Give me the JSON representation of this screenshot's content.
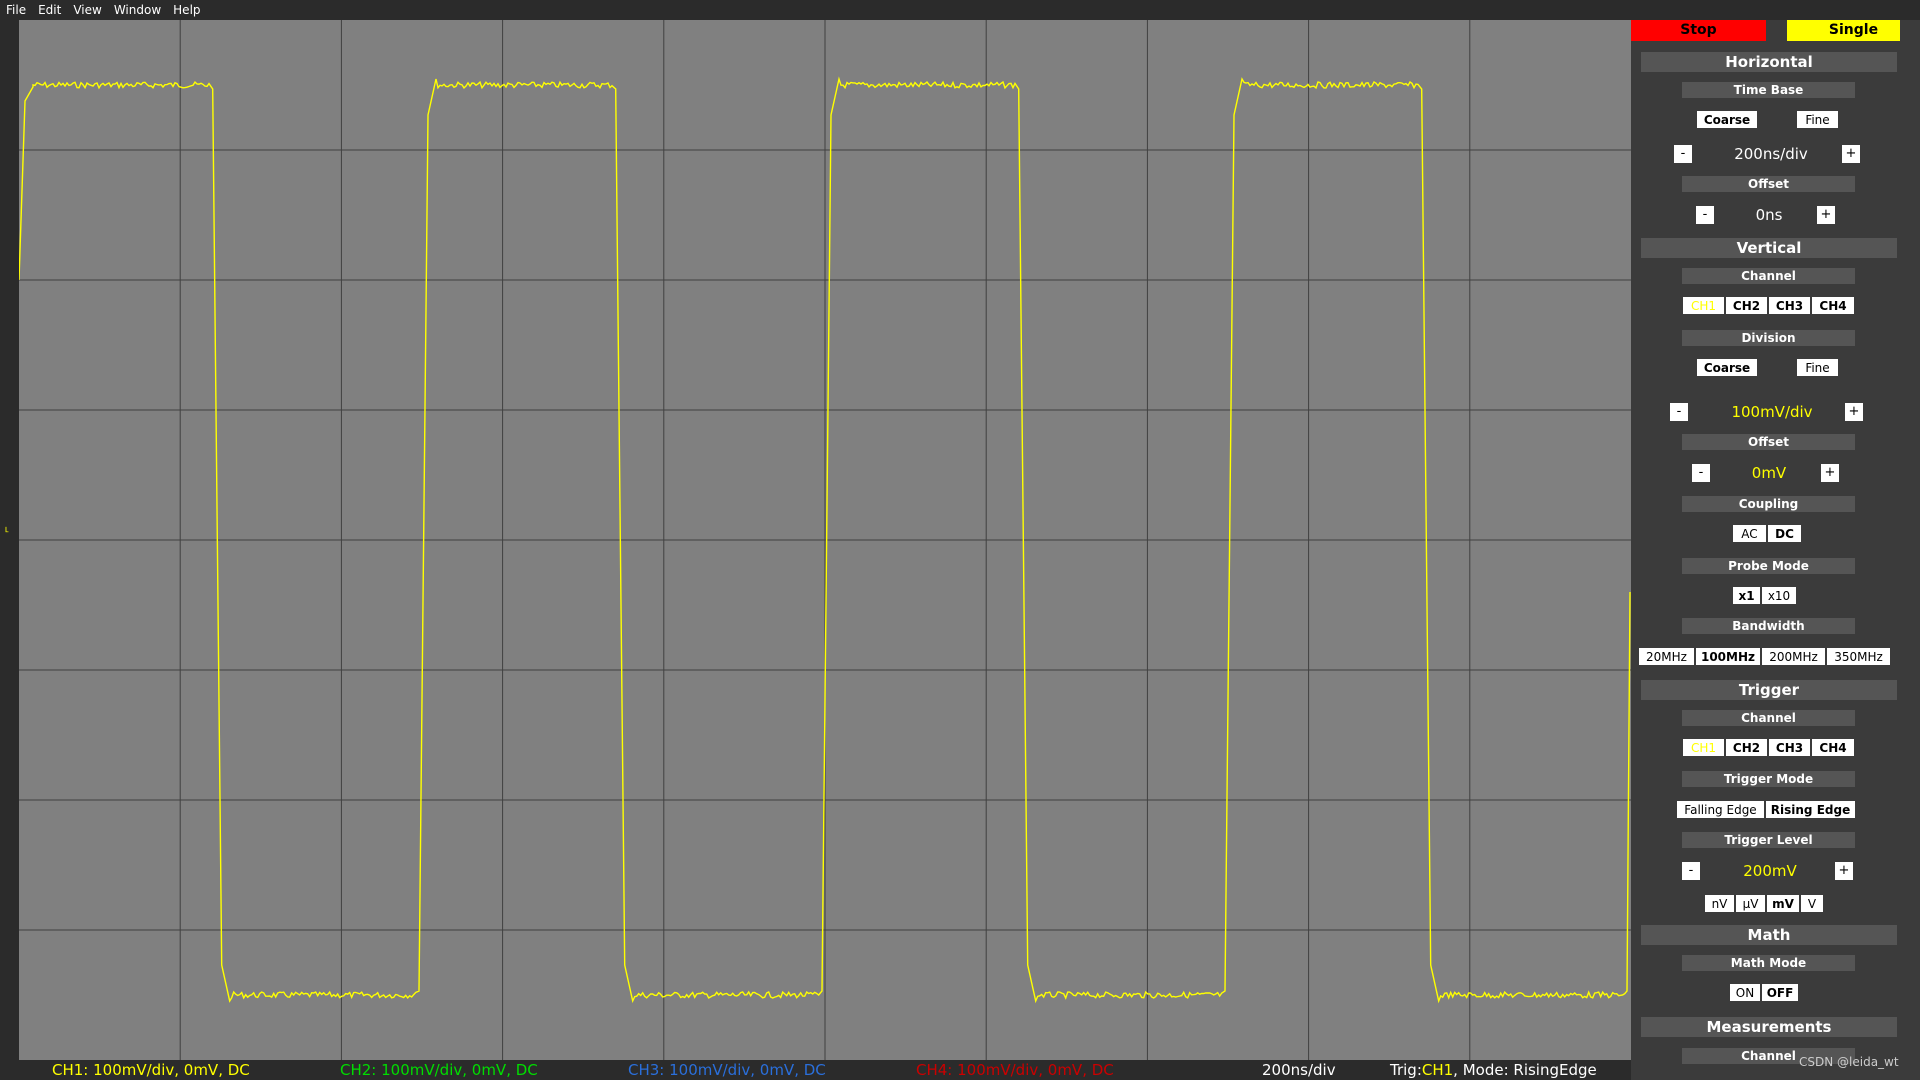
{
  "menu": [
    "File",
    "Edit",
    "View",
    "Window",
    "Help"
  ],
  "trigger_marker": "˪",
  "status": {
    "ch1": "CH1: 100mV/div, 0mV, DC",
    "ch2": "CH2: 100mV/div, 0mV, DC",
    "ch3": "CH3: 100mV/div, 0mV, DC",
    "ch4": "CH4: 100mV/div, 0mV, DC",
    "timebase": "200ns/div",
    "trig_prefix": "Trig:",
    "trig_channel": "CH1",
    "trig_mode": ", Mode: RisingEdge"
  },
  "colors": {
    "ch1": "#ffff00",
    "ch2": "#00dd00",
    "ch3": "#2a6fdb",
    "ch4": "#cc0000",
    "stop": "#ff0000",
    "single": "#ffff00",
    "grid": "#404040",
    "screen": "#808080"
  },
  "panel": {
    "stop": "Stop",
    "single": "Single",
    "horizontal": {
      "title": "Horizontal",
      "time_base": "Time Base",
      "coarse": "Coarse",
      "fine": "Fine",
      "minus": "-",
      "plus": "+",
      "time_value": "200ns/div",
      "offset": "Offset",
      "offset_value": "0ns"
    },
    "vertical": {
      "title": "Vertical",
      "channel": "Channel",
      "channels": [
        "CH1",
        "CH2",
        "CH3",
        "CH4"
      ],
      "division": "Division",
      "coarse": "Coarse",
      "fine": "Fine",
      "div_value": "100mV/div",
      "offset": "Offset",
      "offset_value": "0mV",
      "coupling": "Coupling",
      "ac": "AC",
      "dc": "DC",
      "probe_mode": "Probe Mode",
      "x1": "x1",
      "x10": "x10",
      "bandwidth": "Bandwidth",
      "bandwidths": [
        "20MHz",
        "100MHz",
        "200MHz",
        "350MHz"
      ]
    },
    "trigger": {
      "title": "Trigger",
      "channel": "Channel",
      "channels": [
        "CH1",
        "CH2",
        "CH3",
        "CH4"
      ],
      "trigger_mode": "Trigger Mode",
      "falling": "Falling Edge",
      "rising": "Rising Edge",
      "trigger_level": "Trigger Level",
      "level_value": "200mV",
      "units": [
        "nV",
        "μV",
        "mV",
        "V"
      ]
    },
    "math": {
      "title": "Math",
      "math_mode": "Math Mode",
      "on": "ON",
      "off": "OFF"
    },
    "measurements": {
      "title": "Measurements",
      "channel": "Channel"
    }
  },
  "watermark": "CSDN @leida_wt",
  "chart_data": {
    "type": "line",
    "series_color": "#ffff00",
    "grid_divisions": {
      "x": 10,
      "y": 8
    },
    "timebase_per_div": "200ns/div",
    "volts_per_div": "100mV/div",
    "waveform": "square",
    "high_level_div": 7.5,
    "low_level_div": 0.5,
    "edges_div": [
      {
        "type": "rise_start",
        "x": 0.0
      },
      {
        "type": "fall",
        "x": 1.22
      },
      {
        "type": "rise",
        "x": 2.5
      },
      {
        "type": "fall",
        "x": 3.72
      },
      {
        "type": "rise",
        "x": 5.0
      },
      {
        "type": "fall",
        "x": 6.22
      },
      {
        "type": "rise",
        "x": 7.5
      },
      {
        "type": "fall",
        "x": 8.72
      }
    ]
  }
}
